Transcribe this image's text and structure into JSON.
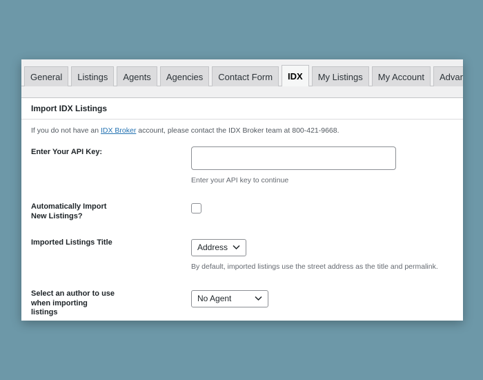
{
  "tabs": [
    {
      "label": "General",
      "active": false
    },
    {
      "label": "Listings",
      "active": false
    },
    {
      "label": "Agents",
      "active": false
    },
    {
      "label": "Agencies",
      "active": false
    },
    {
      "label": "Contact Form",
      "active": false
    },
    {
      "label": "IDX",
      "active": true
    },
    {
      "label": "My Listings",
      "active": false
    },
    {
      "label": "My Account",
      "active": false
    },
    {
      "label": "Advanced",
      "active": false
    }
  ],
  "panel": {
    "title": "Import IDX Listings",
    "intro_before": "If you do not have an ",
    "intro_link": "IDX Broker",
    "intro_after": " account, please contact the IDX Broker team at 800-421-9668."
  },
  "fields": {
    "api_key": {
      "label": "Enter Your API Key:",
      "value": "",
      "description": "Enter your API key to continue"
    },
    "auto_import": {
      "label_line1": "Automatically Import",
      "label_line2": "New Listings?",
      "checked": false
    },
    "listings_title": {
      "label": "Imported Listings Title",
      "selected": "Address",
      "description": "By default, imported listings use the street address as the title and permalink."
    },
    "author": {
      "label_line1": "Select an author to use",
      "label_line2": "when importing",
      "label_line3": "listings",
      "selected": "No Agent"
    }
  },
  "icons": {
    "select_arrow": "chevron-down-icon"
  }
}
